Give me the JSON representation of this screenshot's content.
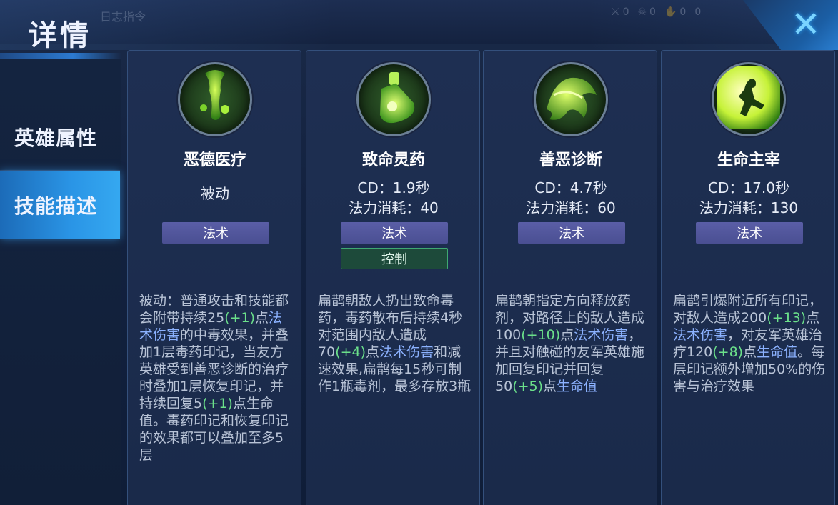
{
  "header": {
    "title": "详情",
    "bg_hint": "日志指令",
    "stats": [
      "0",
      "0",
      "0",
      "0"
    ],
    "close_icon": "close-icon"
  },
  "sidebar": {
    "items": [
      {
        "label": "英雄属性",
        "active": false
      },
      {
        "label": "技能描述",
        "active": true
      }
    ]
  },
  "skills": [
    {
      "name": "恶德医疗",
      "type_line": "被动",
      "cd": "",
      "mana": "",
      "tags": [
        "法术"
      ],
      "icon": "poison-drip-icon",
      "desc": [
        {
          "t": "被动：普通攻击和技能都会附带持续25",
          "c": ""
        },
        {
          "t": "(+1)",
          "c": "g"
        },
        {
          "t": "点",
          "c": ""
        },
        {
          "t": "法术伤害",
          "c": "b"
        },
        {
          "t": "的中毒效果，并叠加1层毒药印记，当友方英雄受到善恶诊断的治疗时叠加1层恢复印记，并持续回复5",
          "c": ""
        },
        {
          "t": "(+1)",
          "c": "g"
        },
        {
          "t": "点生命值。毒药印记和恢复印记的效果都可以叠加至多5层",
          "c": ""
        }
      ]
    },
    {
      "name": "致命灵药",
      "type_line": "",
      "cd": "CD：1.9秒",
      "mana": "法力消耗：40",
      "tags": [
        "法术",
        "控制"
      ],
      "icon": "potion-flask-icon",
      "desc": [
        {
          "t": "扁鹊朝敌人扔出致命毒药，毒药散布后持续4秒对范围内敌人造成70",
          "c": ""
        },
        {
          "t": "(+4)",
          "c": "g"
        },
        {
          "t": "点",
          "c": ""
        },
        {
          "t": "法术伤害",
          "c": "b"
        },
        {
          "t": "和减速效果,扁鹊每15秒可制作1瓶毒剂，最多存放3瓶",
          "c": ""
        }
      ]
    },
    {
      "name": "善恶诊断",
      "type_line": "",
      "cd": "CD：4.7秒",
      "mana": "法力消耗：60",
      "tags": [
        "法术"
      ],
      "icon": "toxic-splash-icon",
      "desc": [
        {
          "t": "扁鹊朝指定方向释放药剂，对路径上的敌人造成100",
          "c": ""
        },
        {
          "t": "(+10)",
          "c": "g"
        },
        {
          "t": "点",
          "c": ""
        },
        {
          "t": "法术伤害",
          "c": "b"
        },
        {
          "t": "，并且对触碰的友军英雄施加回复印记并回复50",
          "c": ""
        },
        {
          "t": "(+5)",
          "c": "g"
        },
        {
          "t": "点",
          "c": ""
        },
        {
          "t": "生命值",
          "c": "b"
        }
      ]
    },
    {
      "name": "生命主宰",
      "type_line": "",
      "cd": "CD：17.0秒",
      "mana": "法力消耗：130",
      "tags": [
        "法术"
      ],
      "icon": "burst-figure-icon",
      "desc": [
        {
          "t": "扁鹊引爆附近所有印记，对敌人造成200",
          "c": ""
        },
        {
          "t": "(+13)",
          "c": "g"
        },
        {
          "t": "点",
          "c": ""
        },
        {
          "t": "法术伤害",
          "c": "b"
        },
        {
          "t": "，对友军英雄治疗120",
          "c": ""
        },
        {
          "t": "(+8)",
          "c": "g"
        },
        {
          "t": "点",
          "c": ""
        },
        {
          "t": "生命值",
          "c": "b"
        },
        {
          "t": "。每层印记额外增加50%的伤害与治疗效果",
          "c": ""
        }
      ]
    }
  ],
  "colors": {
    "accent_blue": "#2a95e6",
    "tag_magic": "#4a4f92",
    "tag_control": "#1d4a3a",
    "highlight_green": "#6be08a",
    "highlight_blue": "#8cb2ff"
  }
}
